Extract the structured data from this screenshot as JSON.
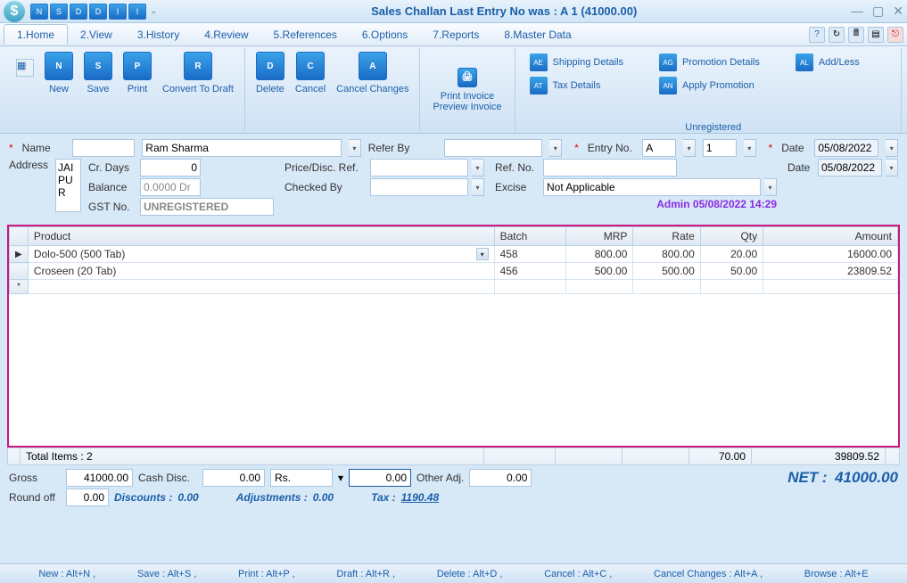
{
  "window": {
    "qat": [
      "N",
      "S",
      "D",
      "D",
      "I",
      "I"
    ],
    "title": "Sales Challan     Last Entry No was : A 1     (41000.00)"
  },
  "menu": {
    "tabs": [
      "1.Home",
      "2.View",
      "3.History",
      "4.Review",
      "5.References",
      "6.Options",
      "7.Reports",
      "8.Master Data"
    ]
  },
  "ribbon": {
    "new": "New",
    "save": "Save",
    "print": "Print",
    "ctd": "Convert To Draft",
    "delete": "Delete",
    "cancel": "Cancel",
    "cc": "Cancel Changes",
    "print_inv": "Print Invoice",
    "preview_inv": "Preview Invoice",
    "ship": "Shipping Details",
    "tax": "Tax Details",
    "promo": "Promotion Details",
    "apply_promo": "Apply Promotion",
    "addless": "Add/Less",
    "unreg": "Unregistered"
  },
  "form": {
    "name_lbl": "Name",
    "name_code": "",
    "name_val": "Ram Sharma",
    "address_lbl": "Address",
    "address_val": "JAIPUR",
    "crdays_lbl": "Cr. Days",
    "crdays_val": "0",
    "balance_lbl": "Balance",
    "balance_val": "0.0000 Dr",
    "gstno_lbl": "GST No.",
    "gstno_val": "UNREGISTERED",
    "referby_lbl": "Refer By",
    "referby_val": "",
    "pricedisc_lbl": "Price/Disc. Ref.",
    "pricedisc_val": "",
    "checkedby_lbl": "Checked By",
    "checkedby_val": "",
    "entryno_lbl": "Entry No.",
    "entryno_series": "A",
    "entryno_num": "1",
    "refno_lbl": "Ref. No.",
    "refno_val": "",
    "excise_lbl": "Excise",
    "excise_val": "Not Applicable",
    "date_lbl": "Date",
    "date1": "05/08/2022",
    "date2": "05/08/2022",
    "audit": "Admin 05/08/2022 14:29"
  },
  "grid": {
    "headers": {
      "product": "Product",
      "batch": "Batch",
      "mrp": "MRP",
      "rate": "Rate",
      "qty": "Qty",
      "amount": "Amount"
    },
    "rows": [
      {
        "product": "Dolo-500 (500 Tab)",
        "batch": "458",
        "mrp": "800.00",
        "rate": "800.00",
        "qty": "20.00",
        "amount": "16000.00"
      },
      {
        "product": "Croseen (20 Tab)",
        "batch": "456",
        "mrp": "500.00",
        "rate": "500.00",
        "qty": "50.00",
        "amount": "23809.52"
      }
    ],
    "total_items_lbl": "Total Items : 2",
    "total_qty": "70.00",
    "total_amount": "39809.52"
  },
  "footer": {
    "gross_lbl": "Gross",
    "gross": "41000.00",
    "cashdisc_lbl": "Cash Disc.",
    "cashdisc": "0.00",
    "currency": "Rs.",
    "curr_amt": "0.00",
    "otheradj_lbl": "Other Adj.",
    "otheradj": "0.00",
    "roundoff_lbl": "Round off",
    "roundoff": "0.00",
    "discounts_lbl": "Discounts :",
    "discounts": "0.00",
    "adjustments_lbl": "Adjustments :",
    "adjustments": "0.00",
    "tax_lbl": "Tax :",
    "tax": "1190.48",
    "net_lbl": "NET :",
    "net": "41000.00"
  },
  "shortcuts": [
    "New : Alt+N ,",
    "Save : Alt+S ,",
    "Print : Alt+P ,",
    "Draft : Alt+R ,",
    "Delete : Alt+D ,",
    "Cancel : Alt+C ,",
    "Cancel Changes : Alt+A ,",
    "Browse : Alt+E"
  ]
}
